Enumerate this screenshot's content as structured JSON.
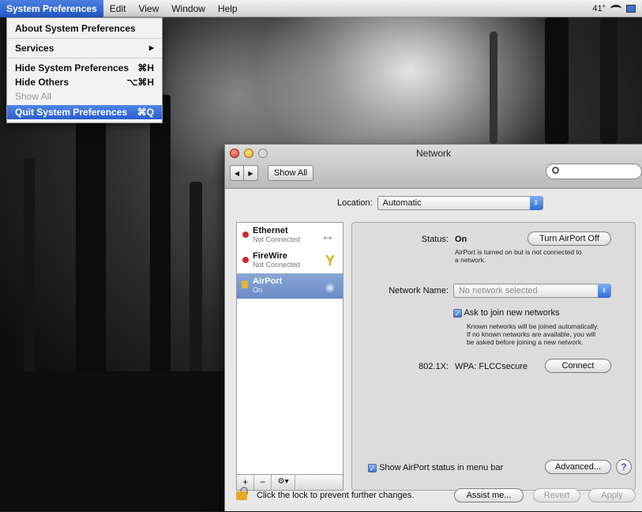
{
  "menubar": {
    "items": [
      "System Preferences",
      "Edit",
      "View",
      "Window",
      "Help"
    ],
    "right": {
      "temp": "41°"
    }
  },
  "app_menu": {
    "about": "About System Preferences",
    "services": "Services",
    "services_arrow": "▶",
    "hide": "Hide System Preferences",
    "hide_shortcut": "⌘H",
    "hide_others": "Hide Others",
    "hide_others_shortcut": "⌥⌘H",
    "show_all": "Show All",
    "quit": "Quit System Preferences",
    "quit_shortcut": "⌘Q"
  },
  "window": {
    "title": "Network",
    "back": "◀",
    "forward": "▶",
    "show_all": "Show All",
    "search_icon": "search-icon"
  },
  "location": {
    "label": "Location:",
    "value": "Automatic",
    "arrow": "⇕"
  },
  "services": [
    {
      "name": "Ethernet",
      "status": "Not Connected",
      "icon": "↔"
    },
    {
      "name": "FireWire",
      "status": "Not Connected",
      "icon": "Y"
    },
    {
      "name": "AirPort",
      "status": "On",
      "icon": "◉"
    }
  ],
  "service_tools": [
    "+",
    "−",
    "⚙▾"
  ],
  "panel": {
    "status_label": "Status:",
    "status_value": "On",
    "turn_off": "Turn AirPort Off",
    "status_note_1": "AirPort is turned on but is not connected to",
    "status_note_2": "a network.",
    "network_name_label": "Network Name:",
    "network_name_placeholder": "No network selected",
    "network_arrow": "⇕",
    "ask_join": "Ask to join new networks",
    "check": "✓",
    "join_note_1": "Known networks will be joined automatically.",
    "join_note_2": "If no known networks are available, you will",
    "join_note_3": "be asked before joining a new network.",
    "dot1x_label": "802.1X:",
    "dot1x_value": "WPA: FLCCsecure",
    "connect": "Connect",
    "show_status": "Show AirPort status in menu bar",
    "advanced": "Advanced...",
    "help": "?"
  },
  "footer": {
    "lock_text": "Click the lock to prevent further changes.",
    "assist": "Assist me...",
    "revert": "Revert",
    "apply": "Apply"
  }
}
